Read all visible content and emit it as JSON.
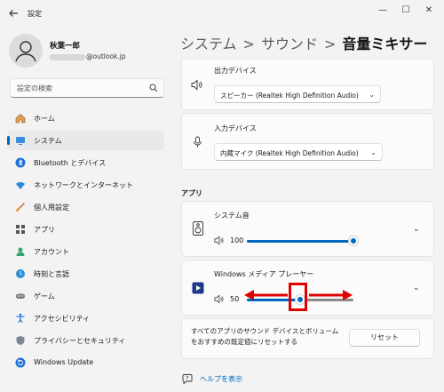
{
  "window": {
    "title": "設定",
    "minimize": "—",
    "maximize": "☐",
    "close": "✕"
  },
  "user": {
    "name": "秋葉一郎",
    "email_suffix": "@outlook.jp"
  },
  "search": {
    "placeholder": "設定の検索"
  },
  "sidebar": {
    "items": [
      {
        "label": "ホーム",
        "icon": "home-icon"
      },
      {
        "label": "システム",
        "icon": "monitor-icon",
        "selected": true
      },
      {
        "label": "Bluetooth とデバイス",
        "icon": "bluetooth-icon"
      },
      {
        "label": "ネットワークとインターネット",
        "icon": "wifi-icon"
      },
      {
        "label": "個人用設定",
        "icon": "brush-icon"
      },
      {
        "label": "アプリ",
        "icon": "apps-icon"
      },
      {
        "label": "アカウント",
        "icon": "account-icon"
      },
      {
        "label": "時刻と言語",
        "icon": "globe-clock-icon"
      },
      {
        "label": "ゲーム",
        "icon": "gamepad-icon"
      },
      {
        "label": "アクセシビリティ",
        "icon": "accessibility-icon"
      },
      {
        "label": "プライバシーとセキュリティ",
        "icon": "shield-icon"
      },
      {
        "label": "Windows Update",
        "icon": "update-icon"
      }
    ]
  },
  "breadcrumb": {
    "part1": "システム",
    "part2": "サウンド",
    "current": "音量ミキサー",
    "separator": ">"
  },
  "output_device": {
    "label": "出力デバイス",
    "value": "スピーカー (Realtek High Definition Audio)"
  },
  "input_device": {
    "label": "入力デバイス",
    "value": "内蔵マイク (Realtek High Definition Audio)"
  },
  "apps_section": {
    "title": "アプリ"
  },
  "system_sounds": {
    "label": "システム音",
    "volume": 100
  },
  "media_player": {
    "label": "Windows メディア プレーヤー",
    "volume": 50
  },
  "reset": {
    "description": "すべてのアプリのサウンド デバイスとボリュームをおすすめの既定値にリセットする",
    "button_label": "リセット"
  },
  "help": {
    "label": "ヘルプを表示"
  },
  "colors": {
    "accent": "#0067c0",
    "annotation": "#e00000"
  }
}
